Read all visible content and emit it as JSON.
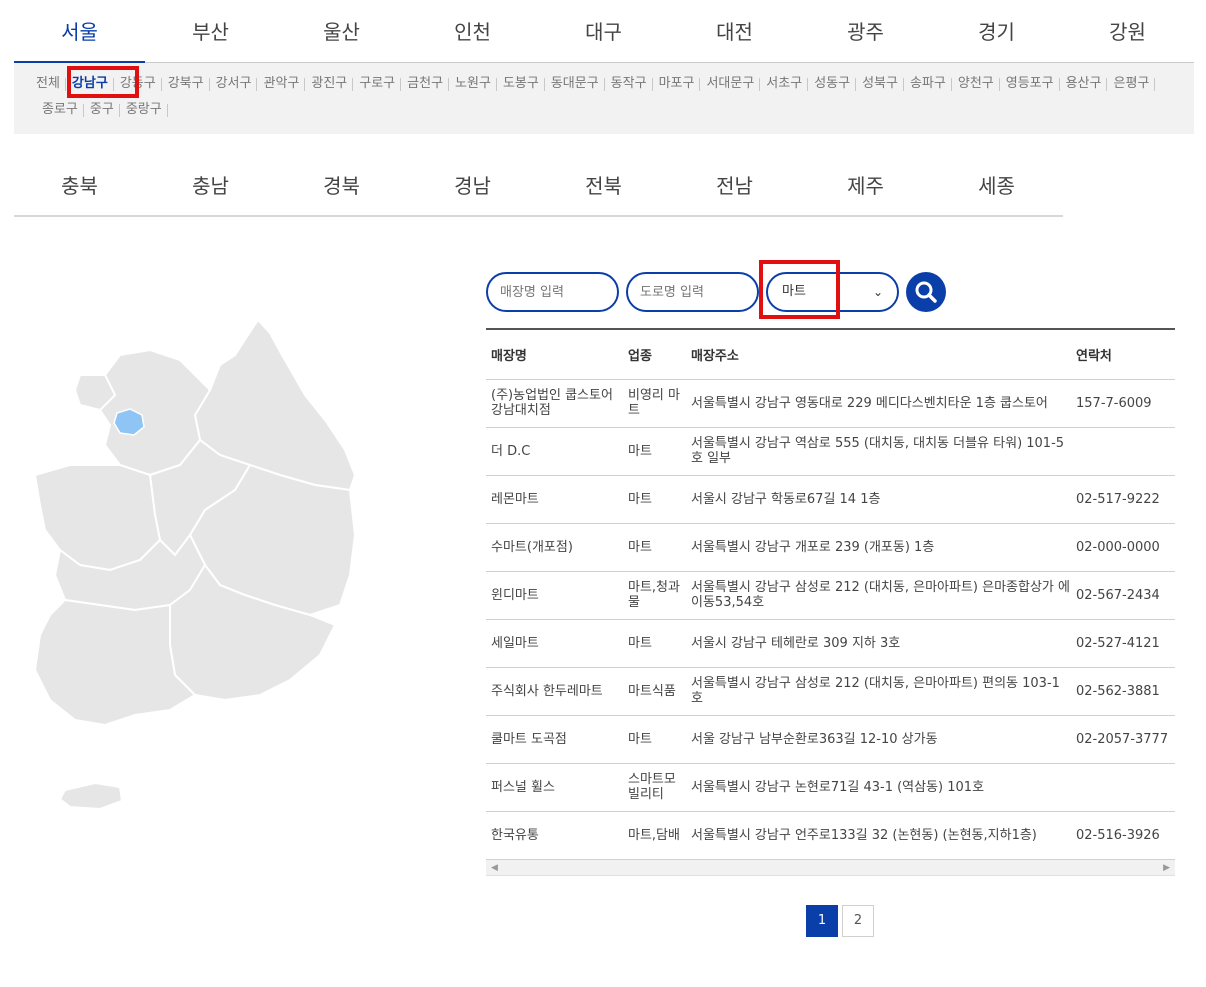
{
  "regions_row1": [
    "서울",
    "부산",
    "울산",
    "인천",
    "대구",
    "대전",
    "광주",
    "경기",
    "강원"
  ],
  "regions_row2": [
    "충북",
    "충남",
    "경북",
    "경남",
    "전북",
    "전남",
    "제주",
    "세종"
  ],
  "active_region": "서울",
  "districts": [
    "전체",
    "강남구",
    "강동구",
    "강북구",
    "강서구",
    "관악구",
    "광진구",
    "구로구",
    "금천구",
    "노원구",
    "도봉구",
    "동대문구",
    "동작구",
    "마포구",
    "서대문구",
    "서초구",
    "성동구",
    "성북구",
    "송파구",
    "양천구",
    "영등포구",
    "용산구",
    "은평구",
    "종로구",
    "중구",
    "중랑구"
  ],
  "active_district": "강남구",
  "search": {
    "store_placeholder": "매장명 입력",
    "road_placeholder": "도로명 입력",
    "category_value": "마트"
  },
  "table": {
    "headers": [
      "매장명",
      "업종",
      "매장주소",
      "연락처"
    ],
    "rows": [
      [
        "(주)농업법인 쿱스토어 강남대치점",
        "비영리 마트",
        "서울특별시 강남구 영동대로 229 메디다스벤치타운 1층 쿱스토어",
        "157-7-6009"
      ],
      [
        "더 D.C",
        "마트",
        "서울특별시 강남구 역삼로 555 (대치동, 대치동 더블유 타워) 101-5호 일부",
        ""
      ],
      [
        "레몬마트",
        "마트",
        "서울시 강남구 학동로67길 14 1층",
        "02-517-9222"
      ],
      [
        "수마트(개포점)",
        "마트",
        "서울특별시 강남구 개포로 239 (개포동) 1층",
        "02-000-0000"
      ],
      [
        "윈디마트",
        "마트,청과물",
        "서울특별시 강남구 삼성로 212 (대치동, 은마아파트) 은마종합상가 에이동53,54호",
        "02-567-2434"
      ],
      [
        "세일마트",
        "마트",
        "서울시 강남구 테헤란로 309 지하 3호",
        "02-527-4121"
      ],
      [
        "주식회사 한두레마트",
        "마트식품",
        "서울특별시 강남구 삼성로 212 (대치동, 은마아파트) 편의동 103-1호",
        "02-562-3881"
      ],
      [
        "쿨마트 도곡점",
        "마트",
        "서울 강남구 남부순환로363길 12-10 상가동",
        "02-2057-3777"
      ],
      [
        "퍼스널 휠스",
        "스마트모빌리티",
        "서울특별시 강남구 논현로71길 43-1 (역삼동) 101호",
        ""
      ],
      [
        "한국유통",
        "마트,담배",
        "서울특별시 강남구 언주로133길 32 (논현동) (논현동,지하1층)",
        "02-516-3926"
      ]
    ]
  },
  "pagination": {
    "pages": [
      "1",
      "2"
    ],
    "current": "1"
  },
  "colors": {
    "accent": "#0a3ea8",
    "highlight": "#e01010",
    "map_fill": "#e6e6e6",
    "map_selected": "#8ec5f5"
  }
}
